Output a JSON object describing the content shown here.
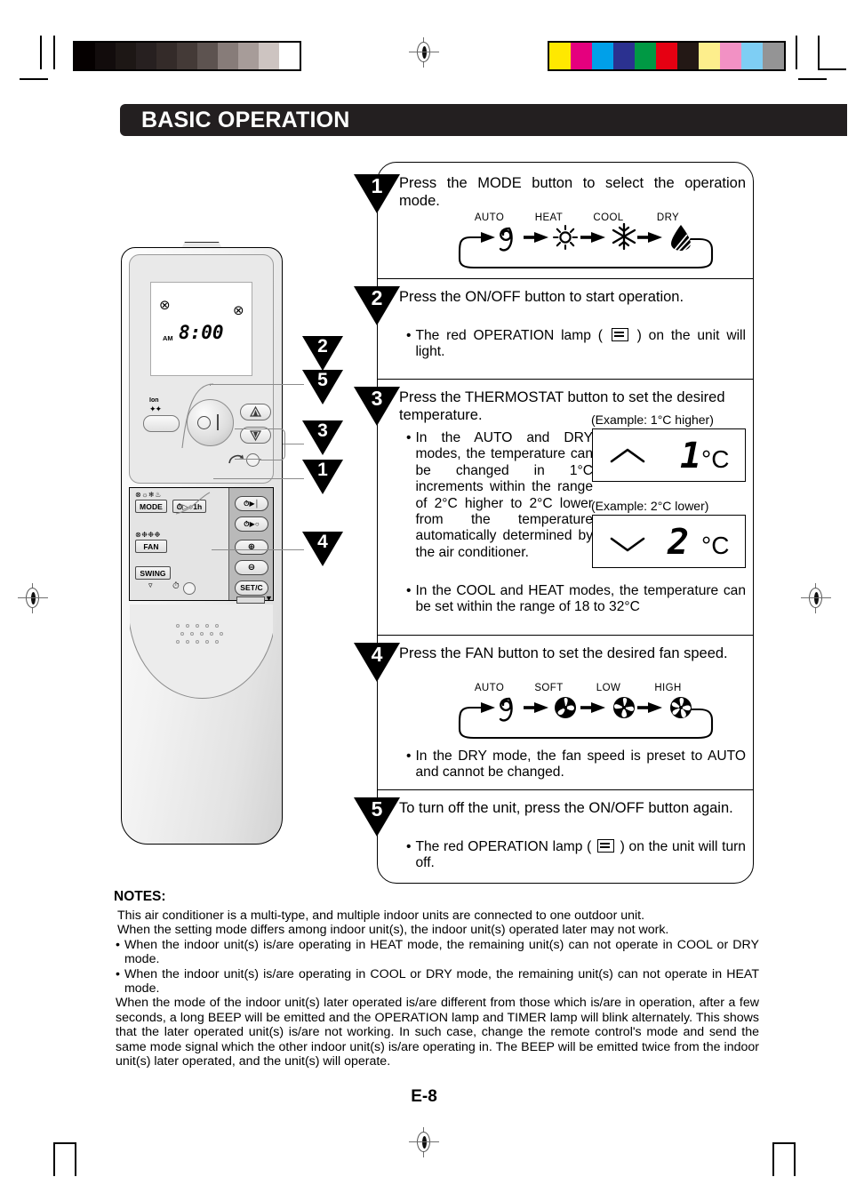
{
  "page": {
    "title": "BASIC OPERATION",
    "page_number": "E-8"
  },
  "steps": [
    {
      "number": "1",
      "text": "Press the MODE button to select the operation mode.",
      "cycle": {
        "labels": [
          "AUTO",
          "HEAT",
          "COOL",
          "DRY"
        ],
        "icons": [
          "auto-swirl-icon",
          "sun-icon",
          "snowflake-icon",
          "droplet-icon"
        ]
      },
      "bullets": []
    },
    {
      "number": "2",
      "text": "Press the ON/OFF button to start operation.",
      "bullets": [
        {
          "before": "The red OPERATION lamp (",
          "icon": "operation-lamp-icon",
          "after": ") on the unit will light."
        }
      ]
    },
    {
      "number": "3",
      "text": "Press the THERMOSTAT button to set the desired temperature.",
      "bullets": [
        {
          "text": "In the AUTO and DRY modes, the temperature can be changed in 1°C increments within the range of 2°C higher to 2°C lower from the temperature automatically determined by the air conditioner."
        },
        {
          "text": "In the COOL and HEAT modes, the temperature can be set within the range of 18 to 32°C"
        }
      ],
      "examples": [
        {
          "caption": "(Example: 1°C higher)",
          "arrow": "chevron-up-icon",
          "value": "1",
          "unit": "°C"
        },
        {
          "caption": "(Example: 2°C lower)",
          "arrow": "chevron-down-icon",
          "value": "2",
          "unit": "°C"
        }
      ]
    },
    {
      "number": "4",
      "text": "Press the FAN button to set the desired fan speed.",
      "cycle": {
        "labels": [
          "AUTO",
          "SOFT",
          "LOW",
          "HIGH"
        ],
        "icons": [
          "auto-swirl-icon",
          "fan-soft-icon",
          "fan-low-icon",
          "fan-high-icon"
        ]
      },
      "bullets": [
        {
          "text": "In the DRY mode, the fan speed is preset to AUTO and cannot be changed."
        }
      ]
    },
    {
      "number": "5",
      "text": "To turn off the unit, press the ON/OFF button again.",
      "bullets": [
        {
          "before": "The red OPERATION lamp (",
          "icon": "operation-lamp-icon",
          "after": ") on the unit will turn off."
        }
      ]
    }
  ],
  "remote": {
    "lcd": {
      "am": "AM",
      "time": "8:00"
    },
    "ion_label": "Ion",
    "keys": {
      "mode": "MODE",
      "timer_1h": "1h",
      "fan": "FAN",
      "swing": "SWING",
      "set_c": "SET/C"
    },
    "callouts": [
      "2",
      "5",
      "3",
      "1",
      "4"
    ]
  },
  "notes": {
    "heading": "NOTES:",
    "paragraphs": [
      "This air conditioner is a multi-type, and multiple indoor units are connected to one outdoor unit.",
      "When the setting mode differs among indoor unit(s), the indoor unit(s) operated later may not work."
    ],
    "bullets": [
      "When the indoor unit(s) is/are operating in HEAT mode, the remaining unit(s) can not operate in COOL or DRY mode.",
      "When the indoor unit(s) is/are operating in COOL or DRY mode, the remaining unit(s) can not operate in HEAT mode."
    ],
    "closing": "When the mode of the indoor unit(s) later operated is/are different from those which is/are in operation, after a few seconds, a long BEEP will be emitted and the OPERATION lamp and TIMER lamp will blink alternately. This shows that the later operated unit(s) is/are not working. In such case, change the remote control's mode and send the same mode signal which the other indoor unit(s) is/are operating in. The BEEP will be emitted twice from the indoor unit(s) later operated, and the unit(s) will operate."
  },
  "print_marks": {
    "gray_bar": [
      "#050000",
      "#120c0c",
      "#1d1715",
      "#272020",
      "#342b29",
      "#443a37",
      "#5d5350",
      "#877c79",
      "#a79c99",
      "#cdc4c1",
      "#ffffff"
    ],
    "color_bar": [
      "#ffe800",
      "#e5007e",
      "#00a0e9",
      "#2b3190",
      "#009944",
      "#e60012",
      "#231815",
      "#fdee8c",
      "#f291c4",
      "#7ecef4",
      "#949495"
    ]
  }
}
